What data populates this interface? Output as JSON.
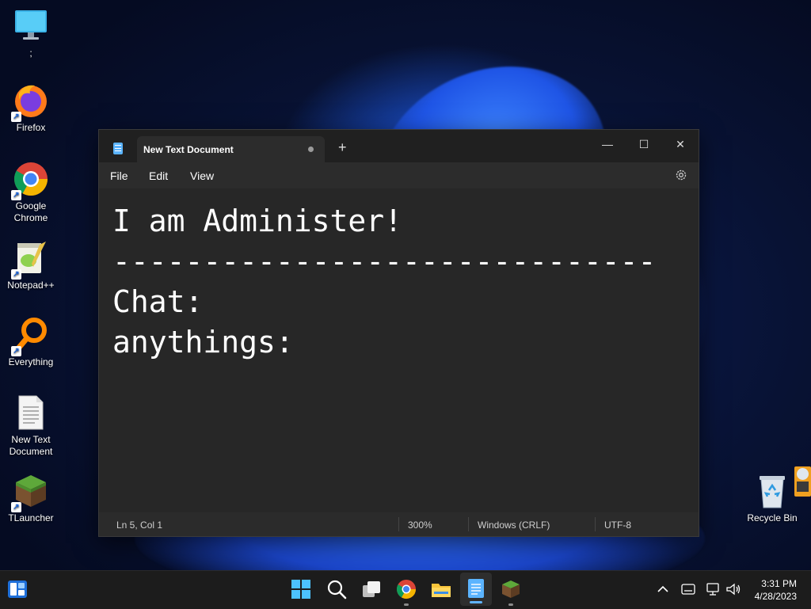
{
  "desktop": {
    "icons": [
      {
        "label": ";"
      },
      {
        "label": "Firefox"
      },
      {
        "label": "Google\nChrome"
      },
      {
        "label": "Notepad++"
      },
      {
        "label": "Everything"
      },
      {
        "label": "New Text\nDocument"
      },
      {
        "label": "TLauncher"
      },
      {
        "label": "Recycle Bin"
      }
    ]
  },
  "notepad": {
    "tab_title": "New Text Document",
    "unsaved_indicator": true,
    "new_tab_symbol": "+",
    "window_controls": {
      "minimize": "—",
      "maximize": "☐",
      "close": "✕"
    },
    "menu": {
      "file": "File",
      "edit": "Edit",
      "view": "View"
    },
    "content_lines": [
      "I am Administer!",
      "------------------------------",
      "Chat:",
      "anythings:"
    ],
    "status": {
      "position": "Ln 5, Col 1",
      "zoom": "300%",
      "line_ending": "Windows (CRLF)",
      "encoding": "UTF-8"
    }
  },
  "taskbar": {
    "apps": [
      "widgets",
      "start",
      "search",
      "task-view",
      "chrome",
      "file-explorer",
      "notepad",
      "tlauncher"
    ],
    "active_app": "notepad",
    "clock": {
      "time": "3:31 PM",
      "date": "4/28/2023"
    }
  },
  "colors": {
    "accent": "#60b3ff",
    "window_bg": "#272727",
    "titlebar_bg": "#202020",
    "taskbar_bg": "#1c1c1c"
  }
}
